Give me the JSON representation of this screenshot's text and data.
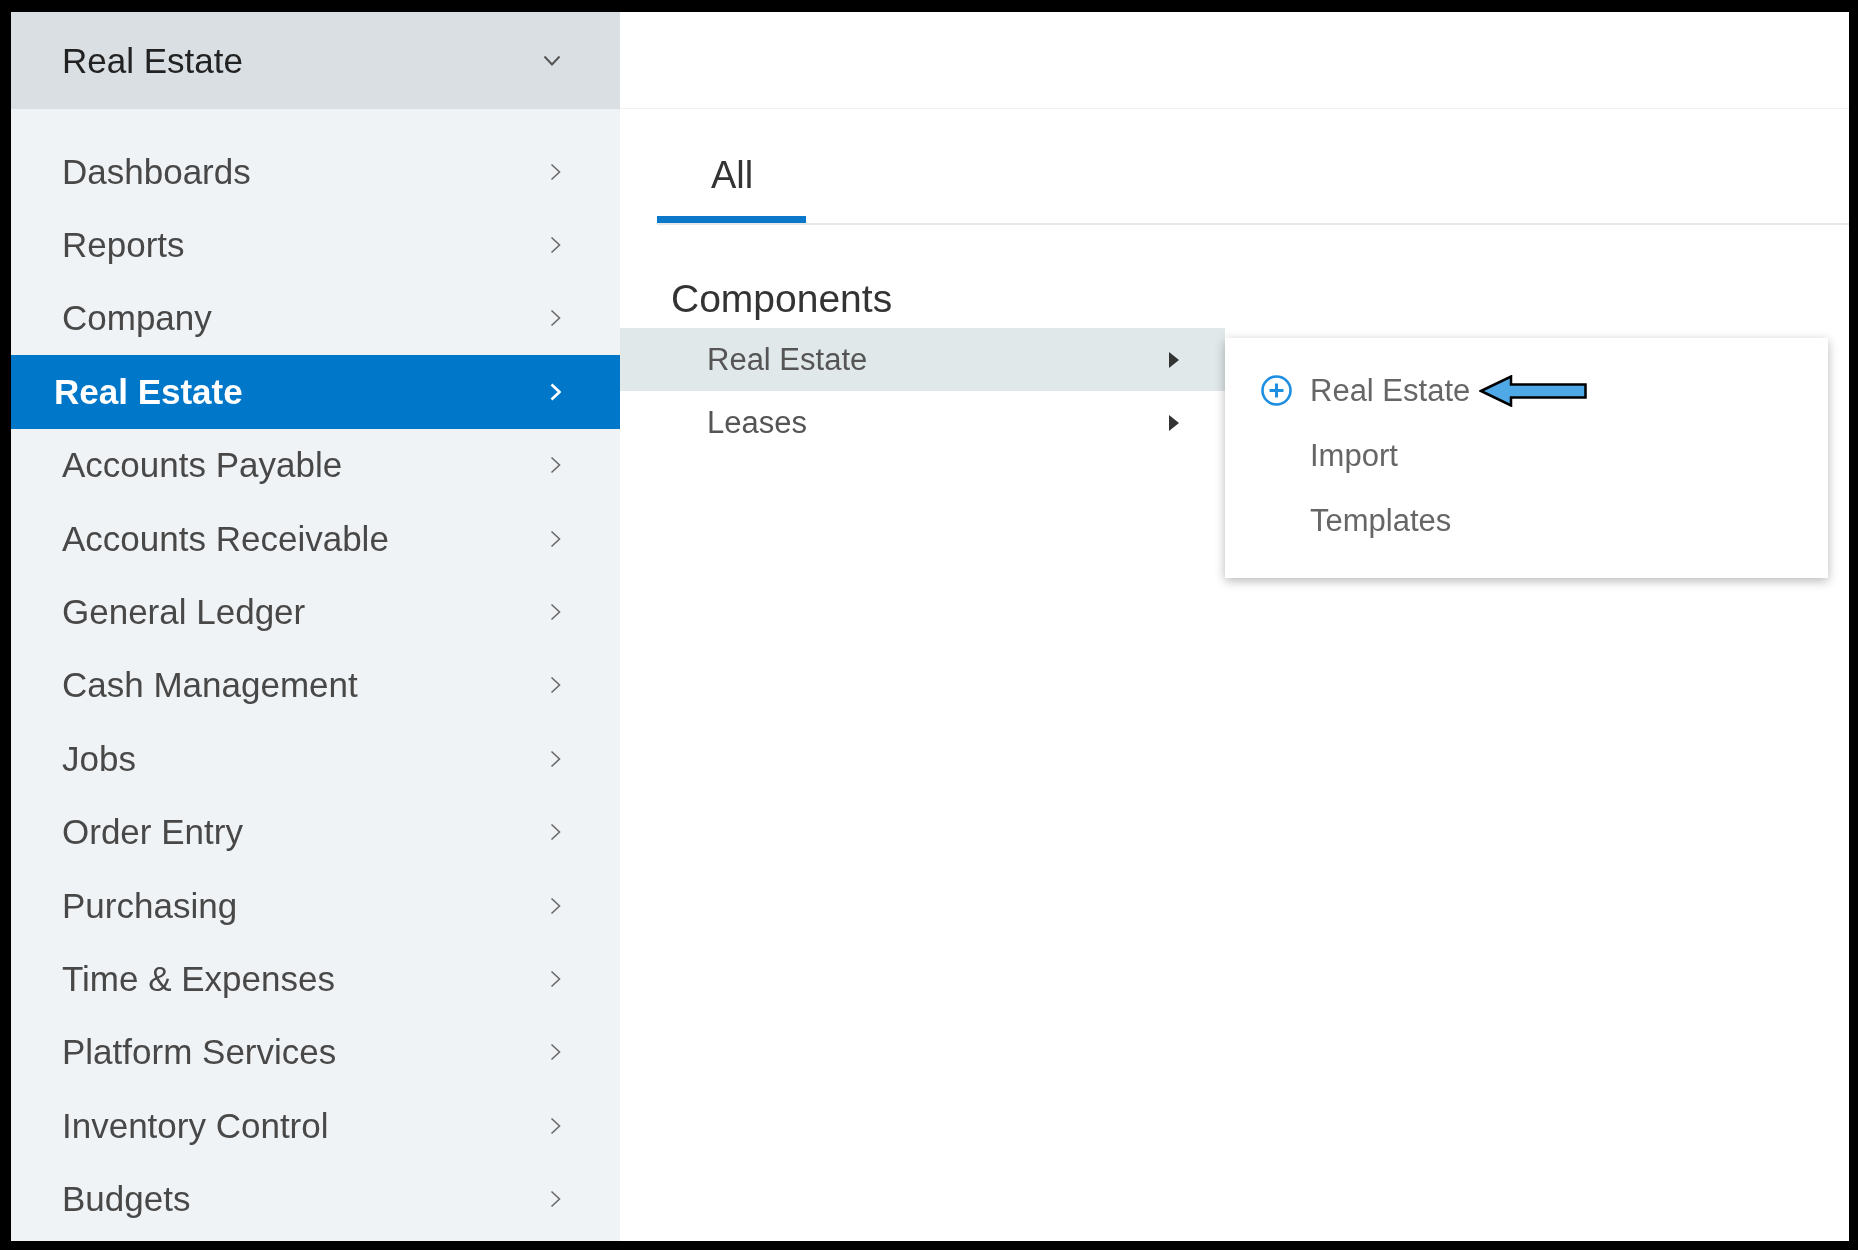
{
  "sidebar": {
    "module_picker": {
      "label": "Real Estate"
    },
    "items": [
      {
        "label": "Dashboards",
        "selected": false
      },
      {
        "label": "Reports",
        "selected": false
      },
      {
        "label": "Company",
        "selected": false
      },
      {
        "label": "Real Estate",
        "selected": true
      },
      {
        "label": "Accounts Payable",
        "selected": false
      },
      {
        "label": "Accounts Receivable",
        "selected": false
      },
      {
        "label": "General Ledger",
        "selected": false
      },
      {
        "label": "Cash Management",
        "selected": false
      },
      {
        "label": "Jobs",
        "selected": false
      },
      {
        "label": "Order Entry",
        "selected": false
      },
      {
        "label": "Purchasing",
        "selected": false
      },
      {
        "label": "Time & Expenses",
        "selected": false
      },
      {
        "label": "Platform Services",
        "selected": false
      },
      {
        "label": "Inventory Control",
        "selected": false
      },
      {
        "label": "Budgets",
        "selected": false
      }
    ]
  },
  "tabs": [
    {
      "label": "All",
      "selected": true
    }
  ],
  "section_title": "Components",
  "menu": {
    "items": [
      {
        "label": "Real Estate",
        "selected": true
      },
      {
        "label": "Leases",
        "selected": false
      }
    ]
  },
  "popup": {
    "items": [
      {
        "label": "Real Estate",
        "kind": "add",
        "arrow": true
      },
      {
        "label": "Import",
        "kind": "plain",
        "arrow": false
      },
      {
        "label": "Templates",
        "kind": "plain",
        "arrow": false
      }
    ]
  }
}
